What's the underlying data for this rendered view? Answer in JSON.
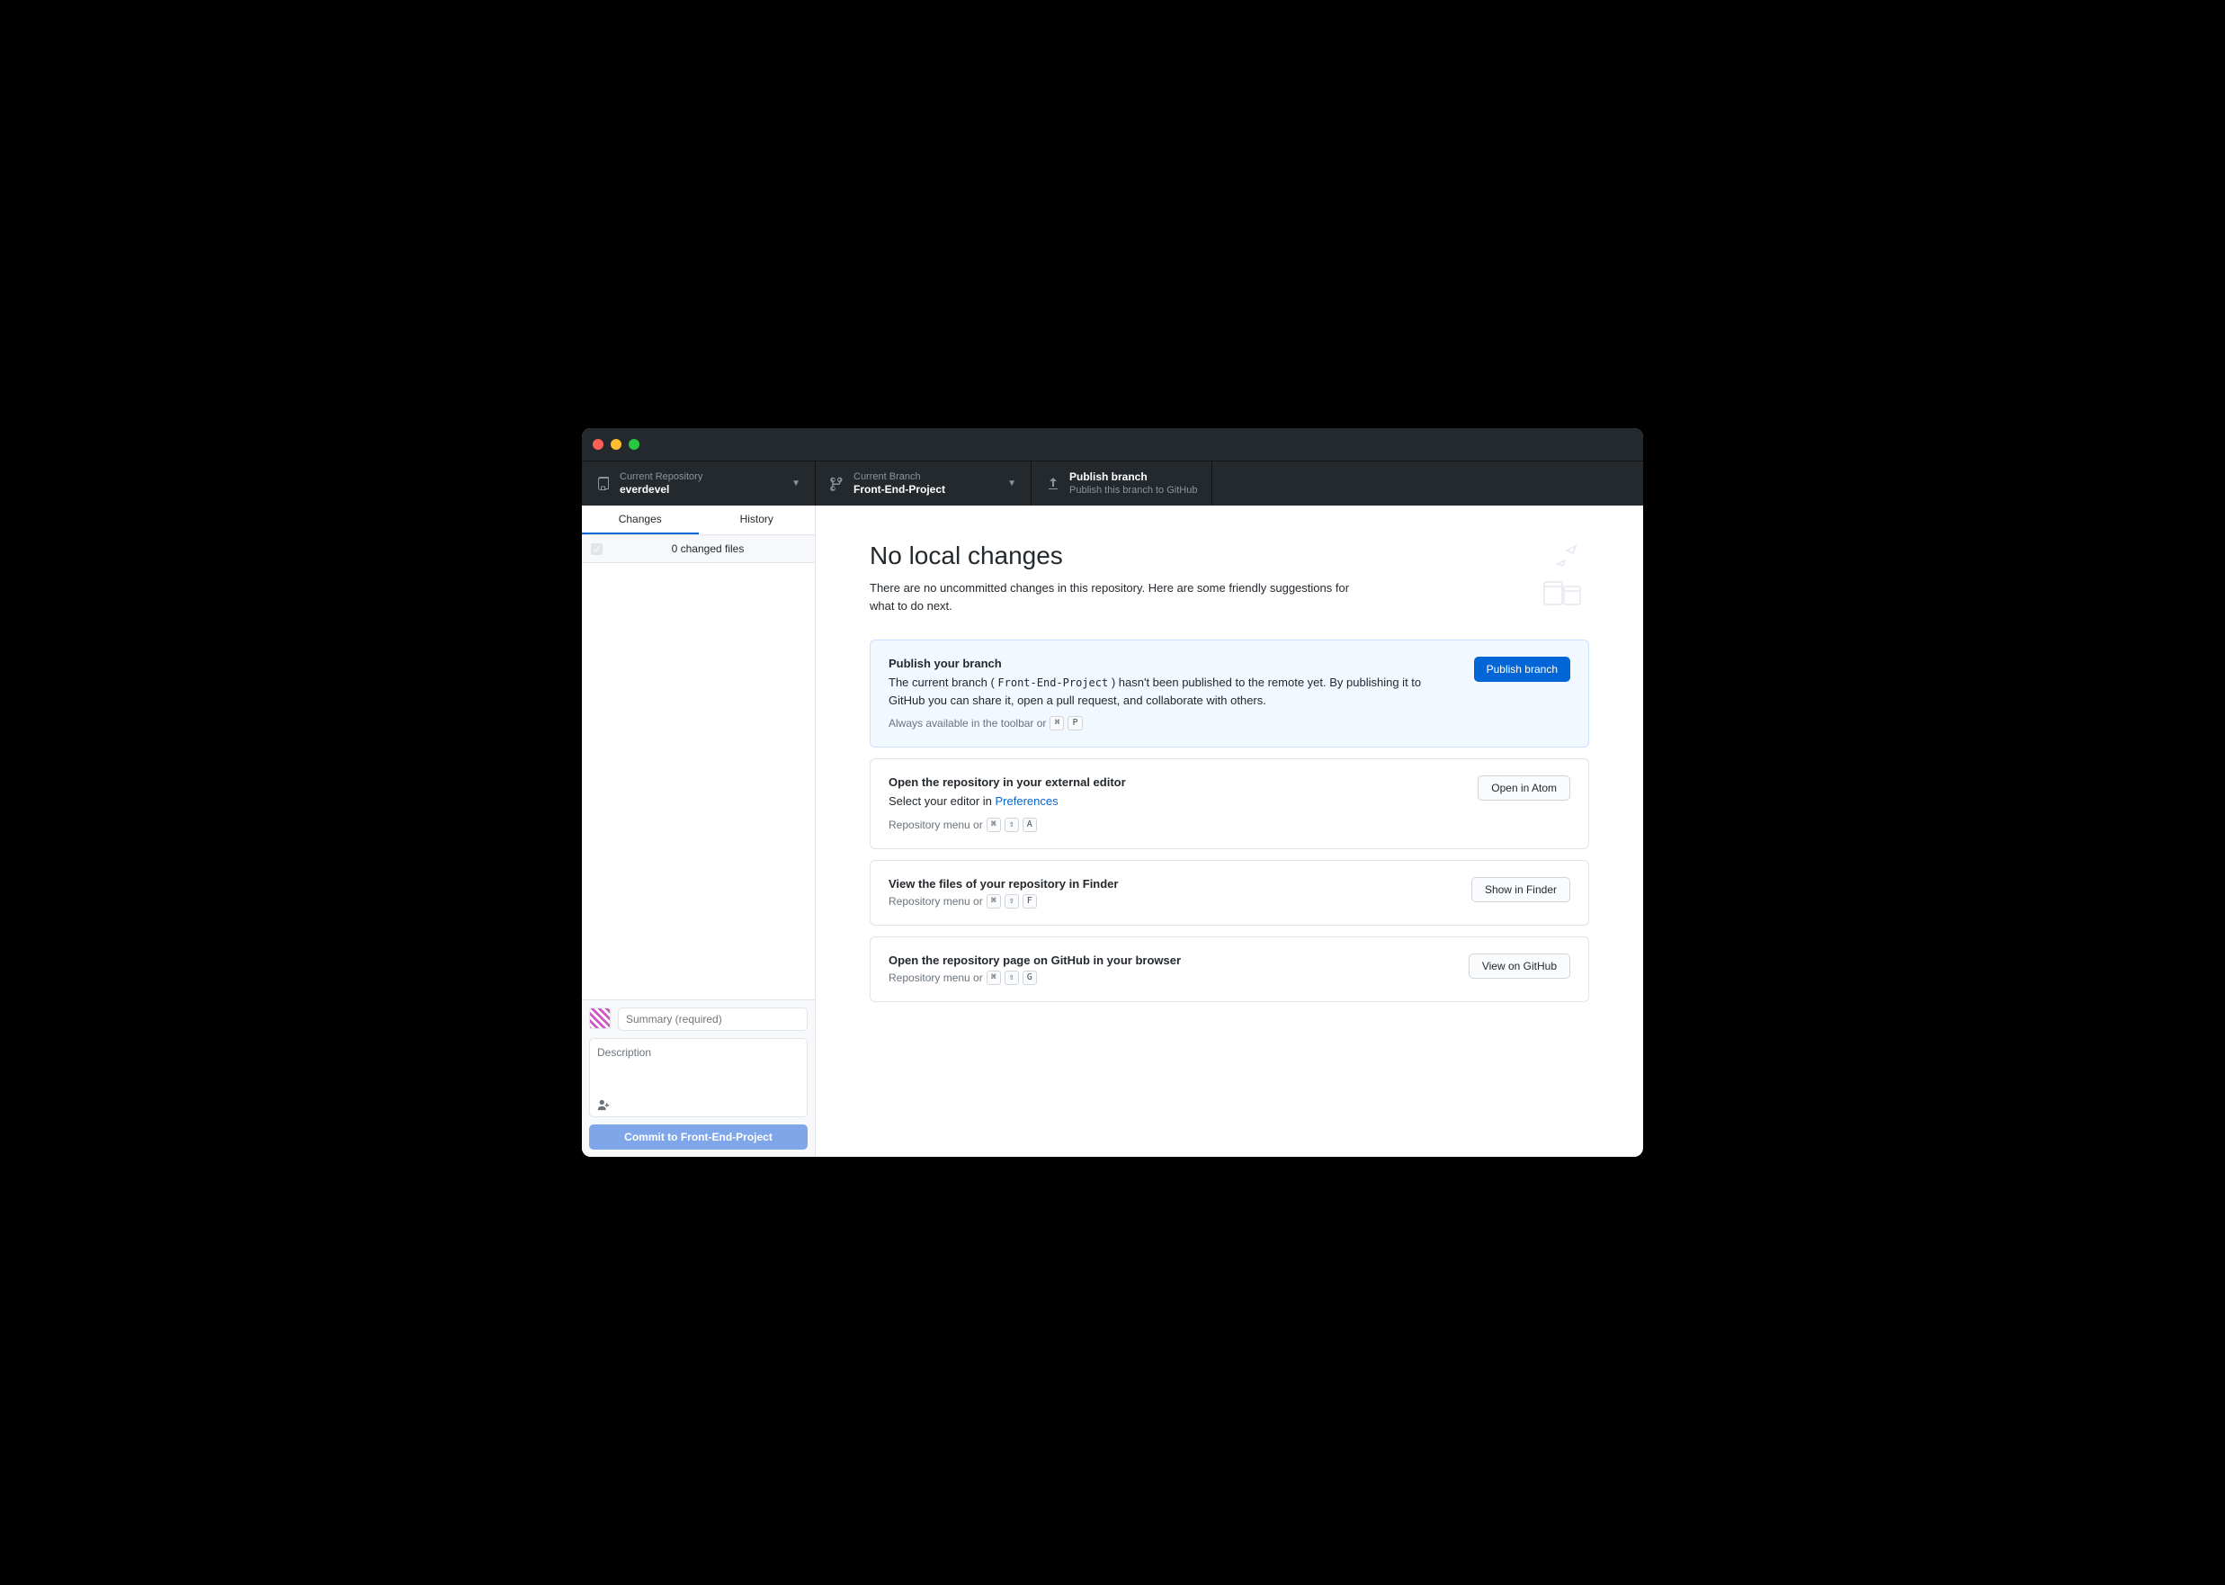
{
  "toolbar": {
    "repo": {
      "label": "Current Repository",
      "value": "everdevel"
    },
    "branch": {
      "label": "Current Branch",
      "value": "Front-End-Project"
    },
    "publish": {
      "label": "Publish branch",
      "value": "Publish this branch to GitHub"
    }
  },
  "sidebar": {
    "tabs": {
      "changes": "Changes",
      "history": "History"
    },
    "changes_count": "0 changed files",
    "summary_placeholder": "Summary (required)",
    "description_placeholder": "Description",
    "commit_prefix": "Commit to ",
    "commit_branch": "Front-End-Project"
  },
  "hero": {
    "title": "No local changes",
    "subtitle": "There are no uncommitted changes in this repository. Here are some friendly suggestions for what to do next."
  },
  "cards": {
    "publish": {
      "title": "Publish your branch",
      "desc_pre": "The current branch ( ",
      "desc_code": "Front-End-Project",
      "desc_post": " ) hasn't been published to the remote yet. By publishing it to GitHub you can share it, open a pull request, and collaborate with others.",
      "hint": "Always available in the toolbar or",
      "kbd1": "⌘",
      "kbd2": "P",
      "button": "Publish branch"
    },
    "editor": {
      "title": "Open the repository in your external editor",
      "desc_pre": "Select your editor in ",
      "link": "Preferences",
      "hint": "Repository menu or",
      "kbd1": "⌘",
      "kbd2": "⇧",
      "kbd3": "A",
      "button": "Open in Atom"
    },
    "finder": {
      "title": "View the files of your repository in Finder",
      "hint": "Repository menu or",
      "kbd1": "⌘",
      "kbd2": "⇧",
      "kbd3": "F",
      "button": "Show in Finder"
    },
    "github": {
      "title": "Open the repository page on GitHub in your browser",
      "hint": "Repository menu or",
      "kbd1": "⌘",
      "kbd2": "⇧",
      "kbd3": "G",
      "button": "View on GitHub"
    }
  }
}
